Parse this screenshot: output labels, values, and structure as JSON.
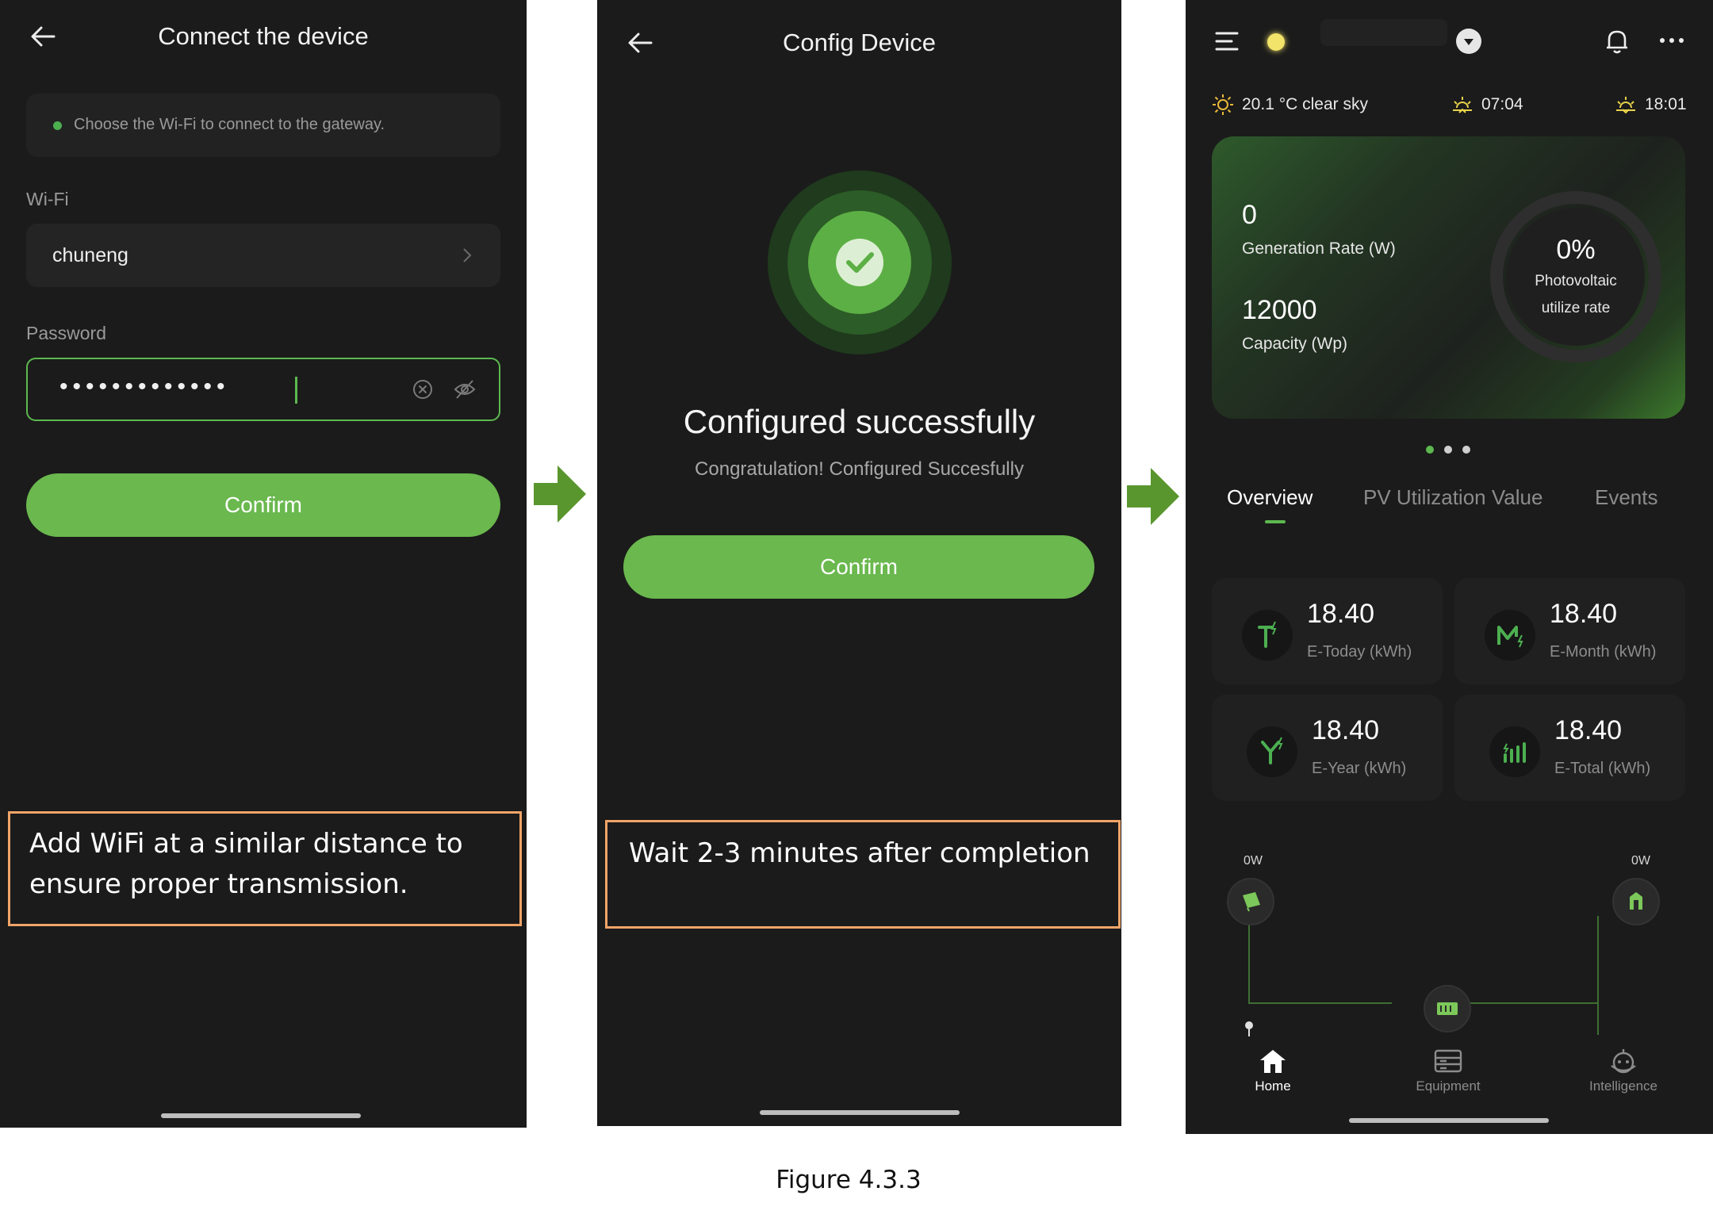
{
  "screen1": {
    "title": "Connect the device",
    "hint": "Choose the Wi-Fi to connect to the gateway.",
    "wifi_label": "Wi-Fi",
    "wifi_value": "chuneng",
    "password_label": "Password",
    "password_mask": "•••••••••••••",
    "confirm_label": "Confirm",
    "note": "Add WiFi at a similar distance to ensure proper transmission."
  },
  "screen2": {
    "title": "Config Device",
    "status_title": "Configured successfully",
    "status_sub": "Congratulation! Configured Succesfully",
    "confirm_label": "Confirm",
    "note": "Wait 2-3 minutes after completion"
  },
  "screen3": {
    "weather": "20.1 °C clear sky",
    "sunrise": "07:04",
    "sunset": "18:01",
    "generation_rate_value": "0",
    "generation_rate_label": "Generation Rate (W)",
    "capacity_value": "12000",
    "capacity_label": "Capacity (Wp)",
    "utilize_value": "0%",
    "utilize_label_1": "Photovoltaic",
    "utilize_label_2": "utilize rate",
    "tabs": [
      "Overview",
      "PV Utilization Value",
      "Events"
    ],
    "tiles": [
      {
        "value": "18.40",
        "label": "E-Today (kWh)"
      },
      {
        "value": "18.40",
        "label": "E-Month (kWh)"
      },
      {
        "value": "18.40",
        "label": "E-Year (kWh)"
      },
      {
        "value": "18.40",
        "label": "E-Total (kWh)"
      }
    ],
    "flow_left": "0W",
    "flow_right": "0W",
    "nav": [
      "Home",
      "Equipment",
      "Intelligence"
    ],
    "colors": {
      "accent": "#6ab84e",
      "background": "#1b1b1b"
    }
  },
  "caption": "Figure 4.3.3"
}
